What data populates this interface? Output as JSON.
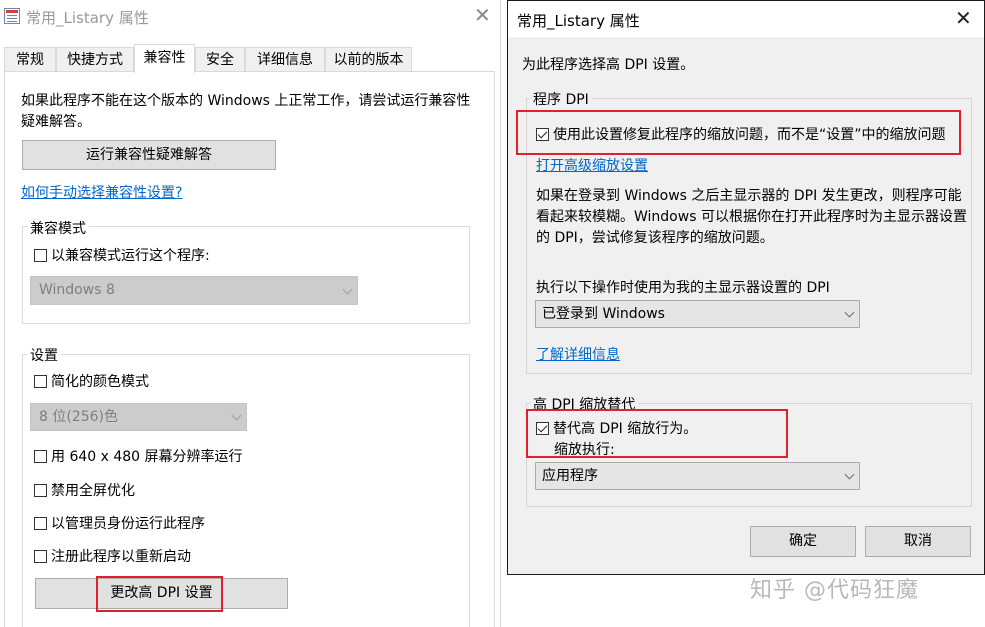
{
  "left_window": {
    "title": "常用_Listary 属性",
    "close_glyph": "✕",
    "tabs": [
      {
        "label": "常规"
      },
      {
        "label": "快捷方式"
      },
      {
        "label": "兼容性"
      },
      {
        "label": "安全"
      },
      {
        "label": "详细信息"
      },
      {
        "label": "以前的版本"
      }
    ],
    "active_tab": "兼容性",
    "intro_text": "如果此程序不能在这个版本的 Windows 上正常工作，请尝试运行兼容性疑难解答。",
    "troubleshooter_button": "运行兼容性疑难解答",
    "manual_link": "如何手动选择兼容性设置?",
    "compat_mode": {
      "group_label": "兼容模式",
      "checkbox_label": "以兼容模式运行这个程序:",
      "checked": false,
      "os_select_value": "Windows 8"
    },
    "settings": {
      "group_label": "设置",
      "reduced_color": {
        "label": "简化的颜色模式",
        "checked": false
      },
      "color_select_value": "8 位(256)色",
      "res_640": {
        "label": "用 640 x 480 屏幕分辨率运行",
        "checked": false
      },
      "disable_fullscreen": {
        "label": "禁用全屏优化",
        "checked": false
      },
      "run_as_admin": {
        "label": "以管理员身份运行此程序",
        "checked": false
      },
      "register_restart": {
        "label": "注册此程序以重新启动",
        "checked": false
      },
      "change_dpi_button": "更改高 DPI 设置"
    }
  },
  "dpi_dialog": {
    "title": "常用_Listary 属性",
    "close_glyph": "✕",
    "heading": "为此程序选择高 DPI 设置。",
    "program_dpi": {
      "group_label": "程序 DPI",
      "checkbox_label": "使用此设置修复此程序的缩放问题，而不是“设置”中的缩放问题",
      "checked": true,
      "advanced_link": "打开高级缩放设置",
      "description": "如果在登录到 Windows 之后主显示器的 DPI 发生更改，则程序可能看起来较模糊。Windows 可以根据你在打开此程序时为主显示器设置的 DPI，尝试修复该程序的缩放问题。",
      "select_label": "执行以下操作时使用为我的主显示器设置的 DPI",
      "select_value": "已登录到 Windows",
      "learn_more_link": "了解详细信息"
    },
    "override": {
      "group_label": "高 DPI 缩放替代",
      "checkbox_label": "替代高 DPI 缩放行为。",
      "checked": true,
      "sub_label": "缩放执行:",
      "select_value": "应用程序"
    },
    "ok_button": "确定",
    "cancel_button": "取消"
  },
  "watermark": "知乎 @代码狂魔",
  "colors": {
    "highlight_red": "#e0202a",
    "link_blue": "#0066cc",
    "dialog_bg": "#f0f0f0"
  }
}
